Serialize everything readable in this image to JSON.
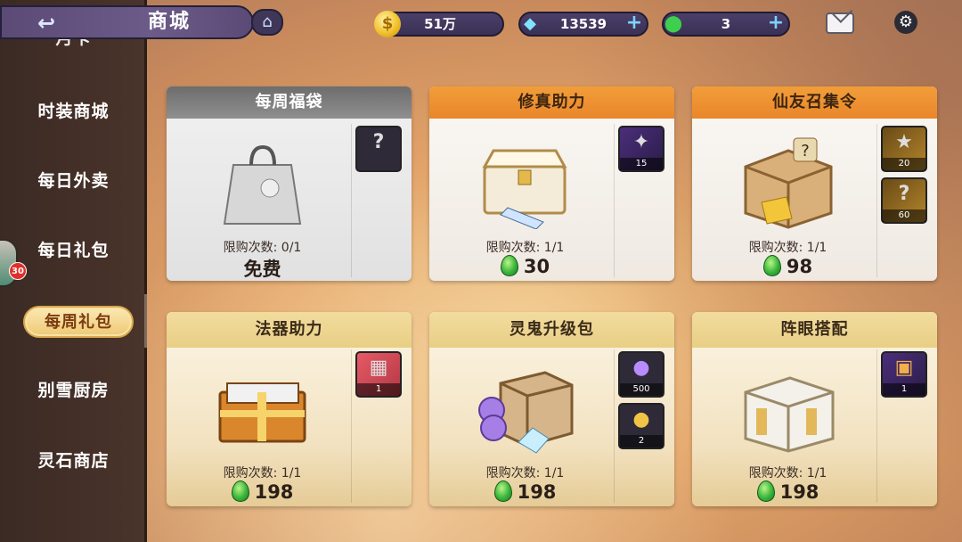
{
  "header": {
    "title": "商城",
    "resources": [
      {
        "name": "coin",
        "value": "51万",
        "has_plus": false
      },
      {
        "name": "crystal",
        "value": "13539",
        "has_plus": true
      },
      {
        "name": "jade",
        "value": "3",
        "has_plus": true
      }
    ]
  },
  "sidebar": {
    "partial_item": "月卡",
    "items": [
      "时装商城",
      "每日外卖",
      "每日礼包",
      "每周礼包",
      "别雪厨房",
      "灵石商店"
    ],
    "active_index": 3,
    "avatar_badge": "30"
  },
  "cards": [
    {
      "title": "每周福袋",
      "style": "gray",
      "limit": "限购次数: 0/1",
      "price": "免费",
      "rewards": [
        {
          "icon": "mystery-puzzle-icon",
          "count": ""
        }
      ]
    },
    {
      "title": "修真助力",
      "style": "orange",
      "limit": "限购次数: 1/1",
      "price": "30",
      "rewards": [
        {
          "icon": "ticket-icon",
          "count": "15"
        }
      ]
    },
    {
      "title": "仙友召集令",
      "style": "orange",
      "limit": "限购次数: 1/1",
      "price": "98",
      "rewards": [
        {
          "icon": "gold-ticket-icon",
          "count": "20"
        },
        {
          "icon": "mystery-puzzle-icon",
          "count": "60"
        }
      ]
    },
    {
      "title": "法器助力",
      "style": "gold",
      "limit": "限购次数: 1/1",
      "price": "198",
      "rewards": [
        {
          "icon": "shop-icon",
          "count": "1"
        }
      ]
    },
    {
      "title": "灵鬼升级包",
      "style": "gold",
      "limit": "限购次数: 1/1",
      "price": "198",
      "rewards": [
        {
          "icon": "purple-coin-icon",
          "count": "500"
        },
        {
          "icon": "gold-coin-icon",
          "count": "2"
        }
      ]
    },
    {
      "title": "阵眼搭配",
      "style": "gold",
      "limit": "限购次数: 1/1",
      "price": "198",
      "rewards": [
        {
          "icon": "mystery-box-icon",
          "count": "1"
        }
      ]
    }
  ]
}
